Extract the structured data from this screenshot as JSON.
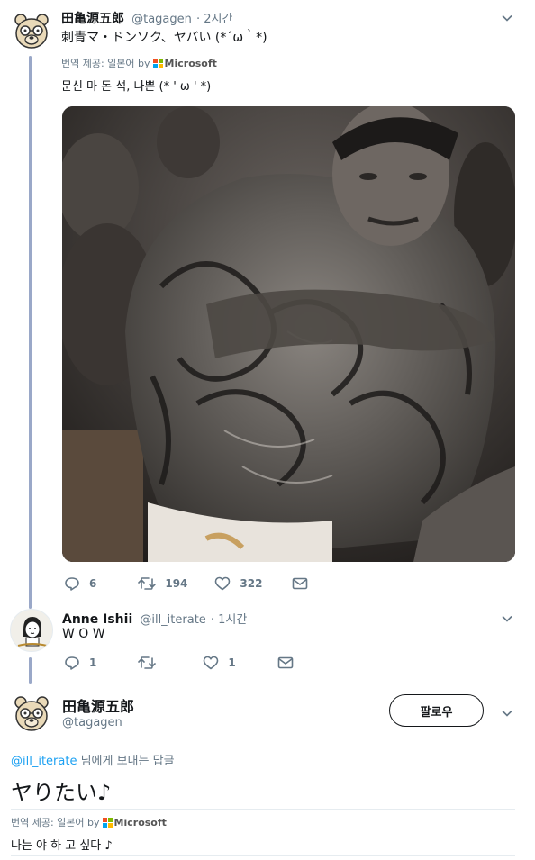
{
  "tweet1": {
    "author": "田亀源五郎",
    "handle": "@tagagen",
    "time": "· 2시간",
    "text": "刺青マ・ドンソク、ヤバい (*´ω｀*)",
    "translate_label": "번역 제공: 일본어 by",
    "ms_label": "Microsoft",
    "translation": "문신 마 돈 석, 나쁜 (* ' ω ' *)",
    "photo_alt": "Tattooed man",
    "replies": "6",
    "retweets": "194",
    "likes": "322"
  },
  "tweet2": {
    "author": "Anne Ishii",
    "handle": "@ill_iterate",
    "time": "· 1시간",
    "text": "W O W",
    "replies": "1",
    "likes": "1"
  },
  "tweet3": {
    "author": "田亀源五郎",
    "handle": "@tagagen",
    "follow_label": "팔로우",
    "reply_to_handle": "@ill_iterate",
    "reply_to_suffix": " 님에게 보내는 답글",
    "text": "ヤりたい♪",
    "translate_label": "번역 제공: 일본어 by",
    "ms_label": "Microsoft",
    "translation": "나는 야 하 고 싶다 ♪"
  },
  "colors": {
    "accent": "#1da1f2",
    "thread_line": "#9aa8c8",
    "muted": "#657786",
    "ms_red": "#f25022",
    "ms_green": "#7fba00",
    "ms_blue": "#00a4ef",
    "ms_yellow": "#ffb900"
  }
}
